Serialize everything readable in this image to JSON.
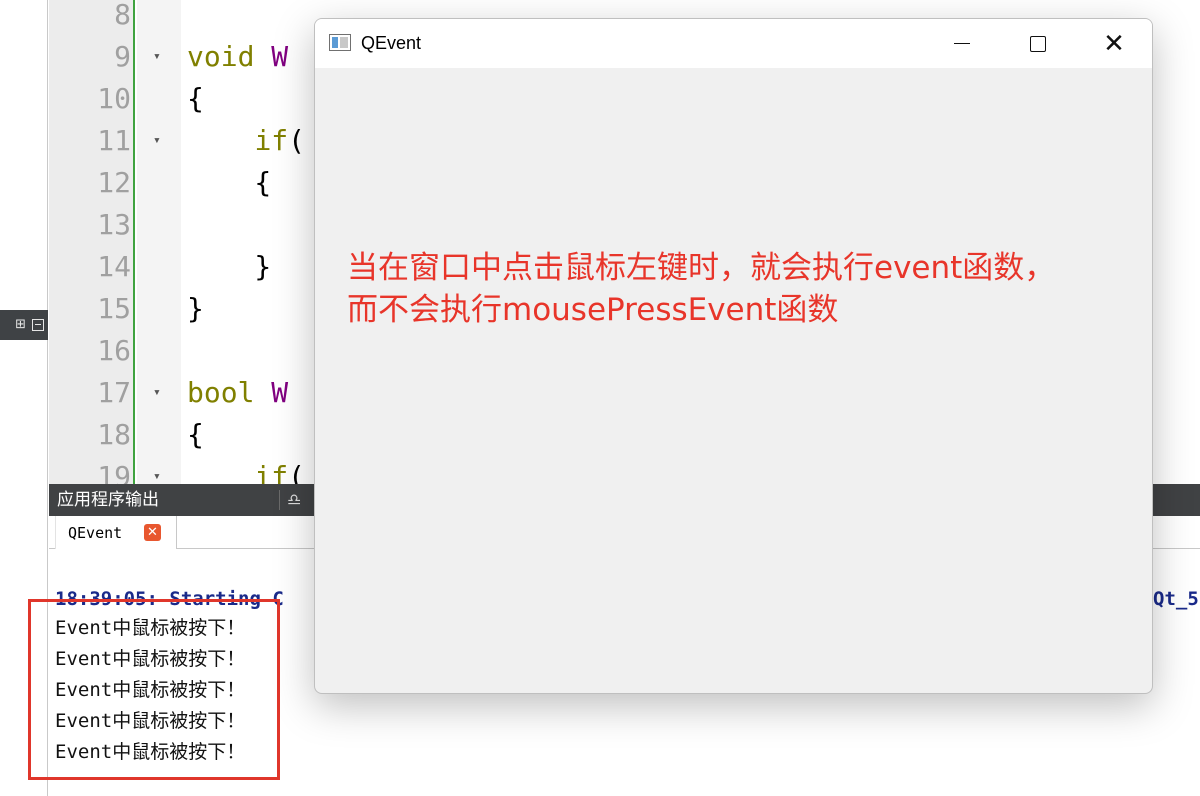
{
  "editor": {
    "lines": [
      {
        "no": "8",
        "fold": "",
        "code": []
      },
      {
        "no": "9",
        "fold": "▾",
        "code": [
          {
            "t": "void",
            "c": "kw"
          },
          {
            "t": " ",
            "c": ""
          },
          {
            "t": "W",
            "c": "fn"
          }
        ]
      },
      {
        "no": "10",
        "fold": "",
        "code": [
          {
            "t": "{",
            "c": ""
          }
        ]
      },
      {
        "no": "11",
        "fold": "▾",
        "code": [
          {
            "t": "    ",
            "c": ""
          },
          {
            "t": "if",
            "c": "kw"
          },
          {
            "t": "(",
            "c": ""
          }
        ]
      },
      {
        "no": "12",
        "fold": "",
        "code": [
          {
            "t": "    {",
            "c": ""
          }
        ]
      },
      {
        "no": "13",
        "fold": "",
        "code": []
      },
      {
        "no": "14",
        "fold": "",
        "code": [
          {
            "t": "    }",
            "c": ""
          }
        ]
      },
      {
        "no": "15",
        "fold": "",
        "code": [
          {
            "t": "}",
            "c": ""
          }
        ]
      },
      {
        "no": "16",
        "fold": "",
        "code": []
      },
      {
        "no": "17",
        "fold": "▾",
        "code": [
          {
            "t": "bool",
            "c": "kw"
          },
          {
            "t": " ",
            "c": ""
          },
          {
            "t": "W",
            "c": "fn"
          }
        ]
      },
      {
        "no": "18",
        "fold": "",
        "code": [
          {
            "t": "{",
            "c": ""
          }
        ]
      },
      {
        "no": "19",
        "fold": "▾",
        "code": [
          {
            "t": "    ",
            "c": ""
          },
          {
            "t": "if",
            "c": "kw"
          },
          {
            "t": "(",
            "c": ""
          }
        ]
      }
    ]
  },
  "output_pane": {
    "header_title": "应用程序输出",
    "tab_label": "QEvent",
    "tab_close_glyph": "✕",
    "start_line": "18:39:05: Starting C",
    "start_line_tail": "Qt_5",
    "lines": [
      "Event中鼠标被按下！",
      "Event中鼠标被按下！",
      "Event中鼠标被按下！",
      "Event中鼠标被按下！",
      "Event中鼠标被按下！"
    ]
  },
  "window": {
    "title": "QEvent",
    "close_glyph": "✕",
    "annotation_line1": "当在窗口中点击鼠标左键时，就会执行event函数，",
    "annotation_line2": "而不会执行mousePressEvent函数"
  },
  "colors": {
    "annotation": "#e8352a",
    "highlight_box": "#e0362b",
    "keyword": "#808000",
    "function": "#800080",
    "start_line": "#1a2a8a"
  },
  "icons": [
    "split-icon",
    "collapse-icon",
    "clean-icon",
    "tab-close-icon",
    "app-icon",
    "minimize-icon",
    "maximize-icon",
    "close-icon"
  ]
}
